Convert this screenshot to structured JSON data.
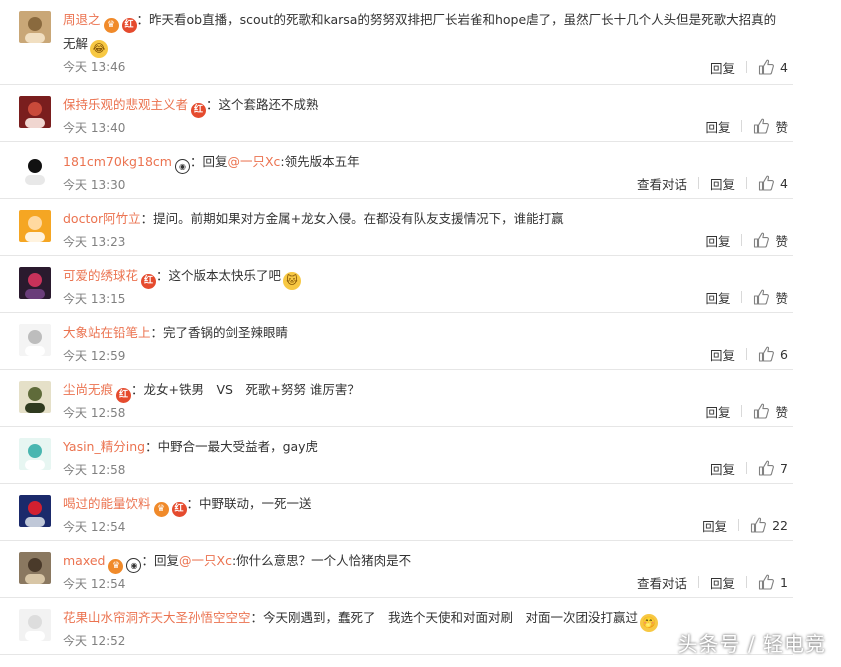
{
  "comments": [
    {
      "user": "周退之",
      "badges": [
        "vip",
        "fan"
      ],
      "pre": "",
      "mention": "",
      "text": "：昨天看ob直播，scout的死歌和karsa的努努双排把厂长岩雀和hope虐了，虽然厂长十几个人头但是死歌大招真的无解",
      "emoji": "😂",
      "time": "今天 13:46",
      "reply": "回复",
      "like": "4",
      "conv": ""
    },
    {
      "user": "保持乐观的悲观主义者",
      "badges": [
        "fan"
      ],
      "pre": "",
      "mention": "",
      "text": "：这个套路还不成熟",
      "emoji": "",
      "time": "今天 13:40",
      "reply": "回复",
      "like": "赞",
      "conv": ""
    },
    {
      "user": "181cm70kg18cm",
      "badges": [
        "panda"
      ],
      "pre": "：回复",
      "mention": "@一只Xc",
      "text": ":领先版本五年",
      "emoji": "",
      "time": "今天 13:30",
      "reply": "回复",
      "like": "4",
      "conv": "查看对话"
    },
    {
      "user": "doctor阿竹立",
      "badges": [],
      "pre": "",
      "mention": "",
      "text": "：提问。前期如果对方金属+龙女入侵。在都没有队友支援情况下，谁能打赢",
      "emoji": "",
      "time": "今天 13:23",
      "reply": "回复",
      "like": "赞",
      "conv": ""
    },
    {
      "user": "可爱的绣球花",
      "badges": [
        "fan"
      ],
      "pre": "",
      "mention": "",
      "text": "：这个版本太快乐了吧",
      "emoji": "🐱",
      "time": "今天 13:15",
      "reply": "回复",
      "like": "赞",
      "conv": ""
    },
    {
      "user": "大象站在铅笔上",
      "badges": [],
      "pre": "",
      "mention": "",
      "text": "：完了香锅的剑圣辣眼睛",
      "emoji": "",
      "time": "今天 12:59",
      "reply": "回复",
      "like": "6",
      "conv": ""
    },
    {
      "user": "尘尚无痕",
      "badges": [
        "fan"
      ],
      "pre": "",
      "mention": "",
      "text": "：龙女+铁男　VS　死歌+努努 谁厉害？",
      "emoji": "",
      "time": "今天 12:58",
      "reply": "回复",
      "like": "赞",
      "conv": ""
    },
    {
      "user": "Yasin_精分ing",
      "badges": [],
      "pre": "",
      "mention": "",
      "text": "：中野合一最大受益者，gay虎",
      "emoji": "",
      "time": "今天 12:58",
      "reply": "回复",
      "like": "7",
      "conv": ""
    },
    {
      "user": "喝过的能量饮料",
      "badges": [
        "vip",
        "fan"
      ],
      "pre": "",
      "mention": "",
      "text": "：中野联动，一死一送",
      "emoji": "",
      "time": "今天 12:54",
      "reply": "回复",
      "like": "22",
      "conv": ""
    },
    {
      "user": "maxed",
      "badges": [
        "vip",
        "panda"
      ],
      "pre": "：回复",
      "mention": "@一只Xc",
      "text": ":你什么意思？一个人恰猪肉是不",
      "emoji": "",
      "time": "今天 12:54",
      "reply": "回复",
      "like": "1",
      "conv": "查看对话"
    },
    {
      "user": "花果山水帘洞齐天大圣孙悟空空空",
      "badges": [],
      "pre": "",
      "mention": "",
      "text": "：今天刚遇到，蠢死了　我选个天使和对面对刷　对面一次团没打赢过",
      "emoji": "🤭",
      "time": "今天 12:52",
      "reply": "",
      "like": "",
      "conv": ""
    }
  ],
  "watermark": "头条号 / 轻电竞",
  "colors": {
    "username": "#eb7350",
    "time": "#808080",
    "text": "#333333",
    "divider": "#e6e6e6"
  }
}
